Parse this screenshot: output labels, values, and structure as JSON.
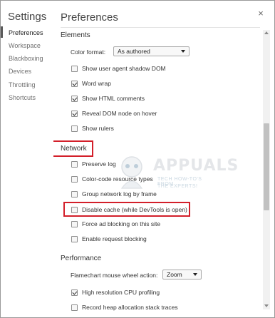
{
  "sidebar": {
    "title": "Settings",
    "items": [
      {
        "label": "Preferences",
        "active": true
      },
      {
        "label": "Workspace",
        "active": false
      },
      {
        "label": "Blackboxing",
        "active": false
      },
      {
        "label": "Devices",
        "active": false
      },
      {
        "label": "Throttling",
        "active": false
      },
      {
        "label": "Shortcuts",
        "active": false
      }
    ]
  },
  "close_glyph": "×",
  "pane": {
    "title": "Preferences",
    "elements": {
      "title": "Elements",
      "color_format_label": "Color format:",
      "color_format_value": "As authored",
      "options": [
        {
          "label": "Show user agent shadow DOM",
          "checked": false
        },
        {
          "label": "Word wrap",
          "checked": true
        },
        {
          "label": "Show HTML comments",
          "checked": true
        },
        {
          "label": "Reveal DOM node on hover",
          "checked": true
        },
        {
          "label": "Show rulers",
          "checked": false
        }
      ]
    },
    "network": {
      "title": "Network",
      "options": [
        {
          "label": "Preserve log",
          "checked": false
        },
        {
          "label": "Color-code resource types",
          "checked": false
        },
        {
          "label": "Group network log by frame",
          "checked": false
        },
        {
          "label": "Disable cache (while DevTools is open)",
          "checked": false
        },
        {
          "label": "Force ad blocking on this site",
          "checked": false
        },
        {
          "label": "Enable request blocking",
          "checked": false
        }
      ]
    },
    "performance": {
      "title": "Performance",
      "flamechart_label": "Flamechart mouse wheel action:",
      "flamechart_value": "Zoom",
      "options": [
        {
          "label": "High resolution CPU profiling",
          "checked": true
        },
        {
          "label": "Record heap allocation stack traces",
          "checked": false
        }
      ]
    }
  },
  "watermark": {
    "text": "APPUALS",
    "line1": "TECH HOW-TO'S FROM",
    "line2": "THE EXPERTS!"
  },
  "colors": {
    "highlight": "#d31f2a",
    "accent_checkbox": "#2a2a2a"
  }
}
